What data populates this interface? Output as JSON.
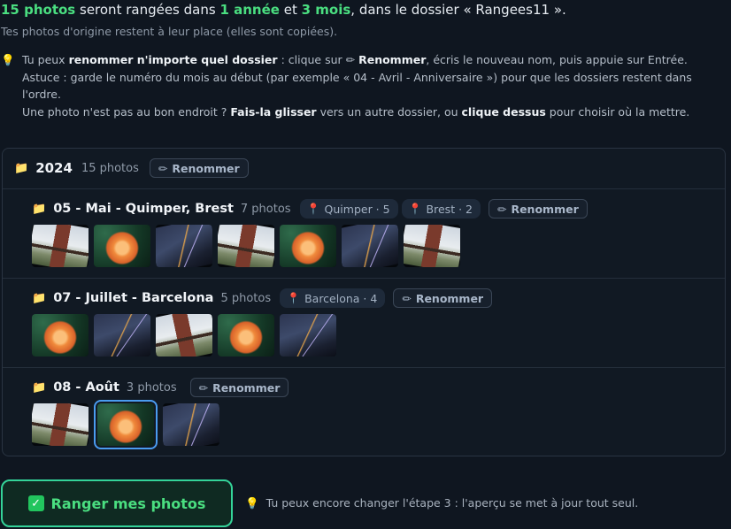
{
  "summary": {
    "count": "15 photos",
    "t1": " seront rangées dans ",
    "years": "1 année",
    "t2": " et ",
    "months": "3 mois",
    "t3": ", dans le dossier « Rangees11 »."
  },
  "subline": "Tes photos d'origine restent à leur place (elles sont copiées).",
  "tips": {
    "icon": "lightbulb-icon",
    "l1a": "Tu peux ",
    "l1b": "renommer n'importe quel dossier",
    "l1c": " : clique sur ✏ ",
    "l1d": "Renommer",
    "l1e": ", écris le nouveau nom, puis appuie sur Entrée. Astuce : garde le numéro du mois au début (par exemple « 04 - Avril - Anniversaire ») pour que les dossiers restent dans l'ordre.",
    "l2a": "Une photo n'est pas au bon endroit ? ",
    "l2b": "Fais-la glisser",
    "l2c": " vers un autre dossier, ou ",
    "l2d": "clique dessus",
    "l2e": " pour choisir où la mettre."
  },
  "year": {
    "title": "2024",
    "count": "15 photos",
    "rename": "Renommer"
  },
  "months": [
    {
      "title": "05 - Mai - Quimper, Brest",
      "count": "7 photos",
      "places": [
        "Quimper · 5",
        "Brest · 2"
      ],
      "rename": "Renommer",
      "photos": [
        "pagoda",
        "flower",
        "night",
        "pagoda",
        "flower",
        "night",
        "pagoda"
      ]
    },
    {
      "title": "07 - Juillet - Barcelona",
      "count": "5 photos",
      "places": [
        "Barcelona · 4"
      ],
      "rename": "Renommer",
      "photos": [
        "flower",
        "night",
        "pagoda",
        "flower",
        "night"
      ]
    },
    {
      "title": "08 - Août",
      "count": "3 photos",
      "places": [],
      "rename": "Renommer",
      "photos": [
        "pagoda",
        "flower",
        "night"
      ],
      "selected_index": 1
    }
  ],
  "action": {
    "label": "Ranger mes photos",
    "icon": "check-icon"
  },
  "hint": "Tu peux encore changer l'étape 3 : l'aperçu se met à jour tout seul.",
  "colors": {
    "accent": "#4ade80",
    "background": "#0f1620",
    "selection": "#4a9cf0",
    "pin": "#e0455a"
  }
}
